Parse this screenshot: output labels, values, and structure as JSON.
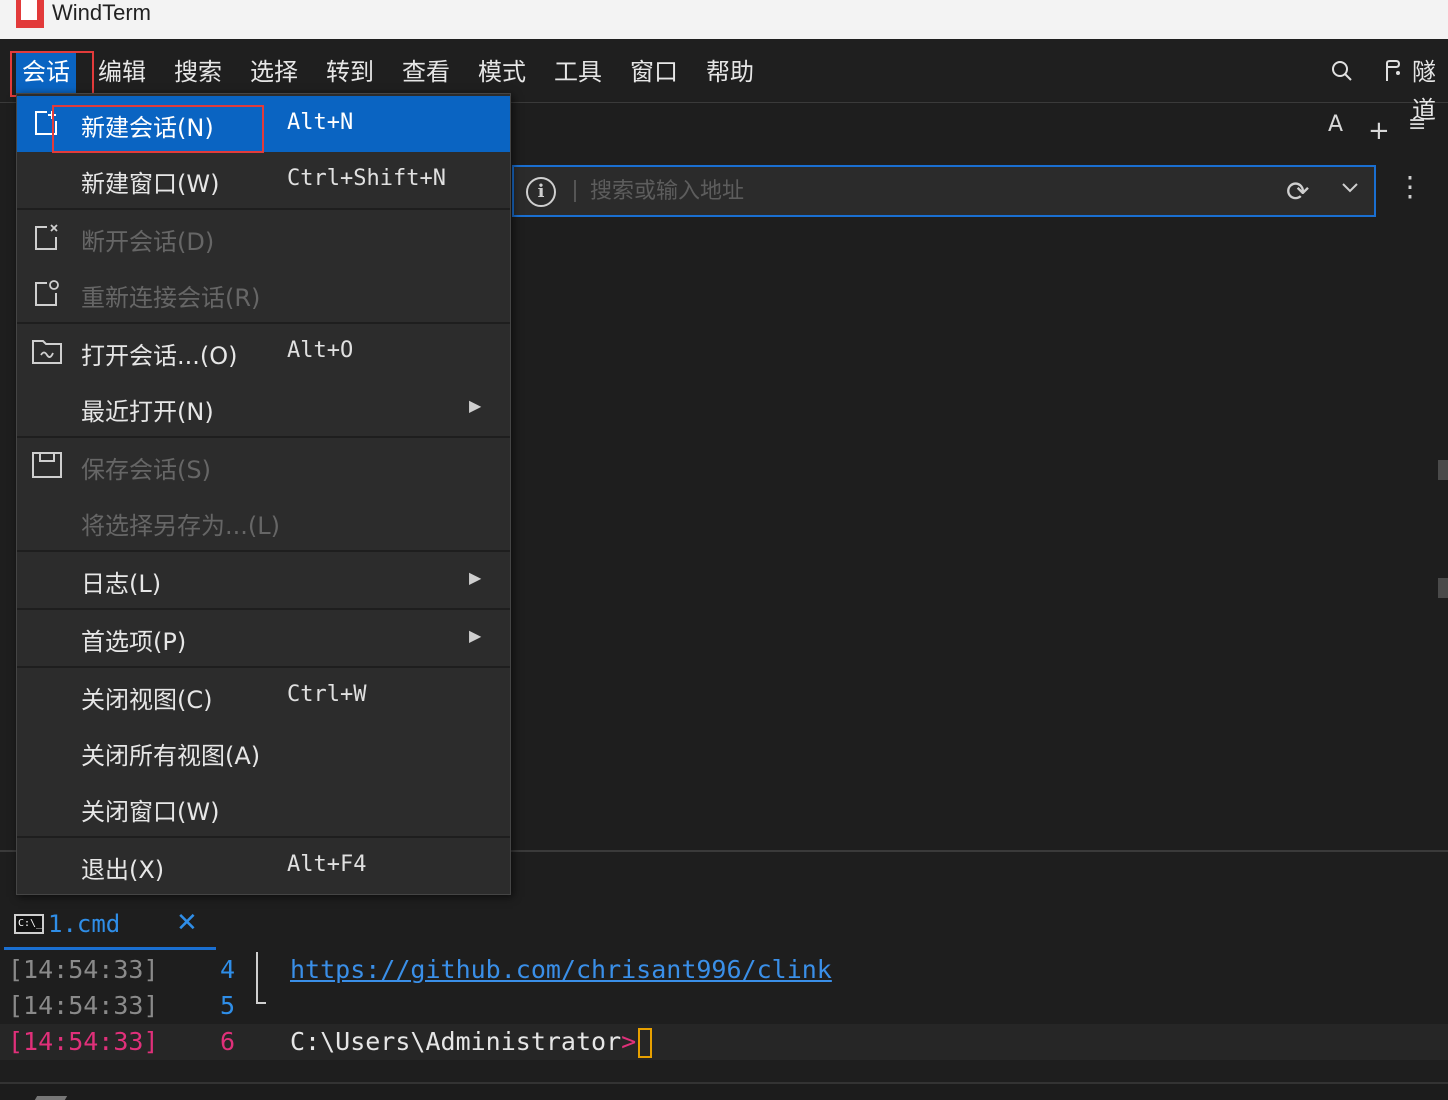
{
  "window": {
    "title": "WindTerm"
  },
  "menubar": {
    "items": [
      "会话",
      "编辑",
      "搜索",
      "选择",
      "转到",
      "查看",
      "模式",
      "工具",
      "窗口",
      "帮助"
    ],
    "tunnel_label": "隧道"
  },
  "toolbar": {
    "font_label": "A",
    "add_label": "+",
    "menu_label": "≡"
  },
  "address": {
    "placeholder": "搜索或输入地址",
    "value": ""
  },
  "session_menu": {
    "items": [
      {
        "label": "新建会话(N)",
        "shortcut": "Alt+N",
        "state": "highlighted",
        "icon": "new-session-icon"
      },
      {
        "label": "新建窗口(W)",
        "shortcut": "Ctrl+Shift+N",
        "state": "enabled",
        "icon": ""
      },
      {
        "label": "断开会话(D)",
        "shortcut": "",
        "state": "disabled",
        "icon": "disconnect-icon"
      },
      {
        "label": "重新连接会话(R)",
        "shortcut": "",
        "state": "disabled",
        "icon": "reconnect-icon"
      },
      {
        "label": "打开会话...(O)",
        "shortcut": "Alt+O",
        "state": "enabled",
        "icon": "open-session-icon"
      },
      {
        "label": "最近打开(N)",
        "shortcut": "",
        "state": "enabled",
        "submenu": true
      },
      {
        "label": "保存会话(S)",
        "shortcut": "",
        "state": "disabled",
        "icon": "save-icon"
      },
      {
        "label": "将选择另存为...(L)",
        "shortcut": "",
        "state": "disabled"
      },
      {
        "label": "日志(L)",
        "shortcut": "",
        "state": "enabled",
        "submenu": true
      },
      {
        "label": "首选项(P)",
        "shortcut": "",
        "state": "enabled",
        "submenu": true
      },
      {
        "label": "关闭视图(C)",
        "shortcut": "Ctrl+W",
        "state": "enabled"
      },
      {
        "label": "关闭所有视图(A)",
        "shortcut": "",
        "state": "enabled"
      },
      {
        "label": "关闭窗口(W)",
        "shortcut": "",
        "state": "enabled"
      },
      {
        "label": "退出(X)",
        "shortcut": "Alt+F4",
        "state": "enabled"
      }
    ]
  },
  "terminal": {
    "tab": {
      "label": "1.cmd",
      "icon_text": "C:\\_"
    },
    "lines": [
      {
        "time": "[14:54:33]",
        "line": "4",
        "text": "https://github.com/chrisant996/clink"
      },
      {
        "time": "[14:54:33]",
        "line": "5",
        "text": ""
      },
      {
        "time": "[14:54:33]",
        "line": "6",
        "text": "C:\\Users\\Administrator",
        "prompt": ">"
      }
    ]
  },
  "colors": {
    "accent": "#0a64c2",
    "highlight_box": "#e23b3b",
    "link": "#3a8fe8",
    "current_line": "#e0307a",
    "cursor": "#e8a000"
  }
}
